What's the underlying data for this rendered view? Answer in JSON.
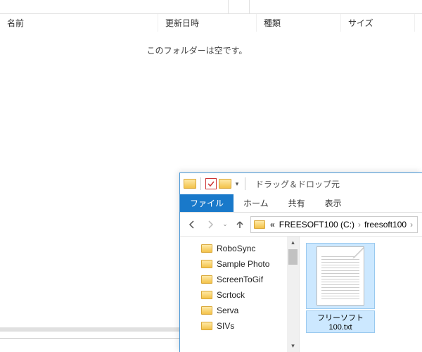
{
  "back": {
    "columns": {
      "name": "名前",
      "date": "更新日時",
      "type": "種類",
      "size": "サイズ"
    },
    "empty": "このフォルダーは空です。"
  },
  "front": {
    "title": "ドラッグ＆ドロップ元",
    "ribbon": {
      "file": "ファイル",
      "home": "ホーム",
      "share": "共有",
      "view": "表示"
    },
    "breadcrumb": {
      "prefix": "«",
      "drive": "FREESOFT100 (C:)",
      "folder": "freesoft100"
    },
    "tree": [
      {
        "label": "RoboSync"
      },
      {
        "label": "Sample Photo"
      },
      {
        "label": "ScreenToGif"
      },
      {
        "label": "Scrtock"
      },
      {
        "label": "Serva"
      },
      {
        "label": "SIVs"
      }
    ],
    "file": {
      "name": "フリーソフト100.txt"
    }
  }
}
